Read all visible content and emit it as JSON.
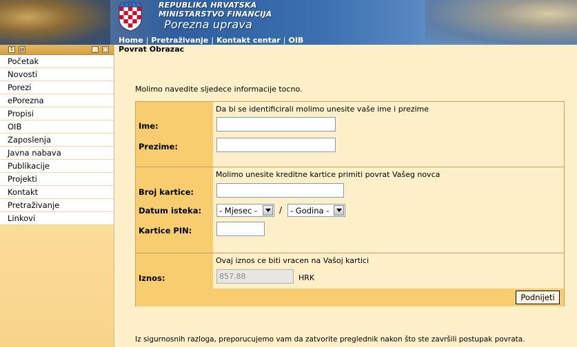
{
  "header": {
    "title_line1": "REPUBLIKA HRVATSKA",
    "title_line2": "MINISTARSTVO FINANCIJA",
    "title_line3": "Porezna uprava"
  },
  "topnav": {
    "items": [
      "Home",
      "Pretraživanje",
      "Kontakt centar",
      "OIB"
    ],
    "separator": "|"
  },
  "sidebar": {
    "items": [
      "Početak",
      "Novosti",
      "Porezi",
      "ePorezna",
      "Propisi",
      "OIB",
      "Zaposlenja",
      "Javna nabava",
      "Publikacije",
      "Projekti",
      "Kontakt",
      "Pretraživanje",
      "Linkovi"
    ]
  },
  "page": {
    "title": "Povrat Obrazac",
    "intro": "Molimo navedite sljedece informacije tocno.",
    "footer_note": "Iz sigurnosnih razloga, preporucujemo vam da zatvorite preglednik nakon što ste završili postupak povrata."
  },
  "form": {
    "section1": {
      "hint": "Da bi se identificirali molimo unesite vaše ime i prezime",
      "name_label": "Ime:",
      "name_value": "",
      "surname_label": "Prezime:",
      "surname_value": ""
    },
    "section2": {
      "hint": "Molimo unesite kreditne kartice primiti povrat Vašeg novca",
      "card_label": "Broj kartice:",
      "card_value": "",
      "expiry_label": "Datum isteka:",
      "month_selected": "- Mjesec -",
      "slash": "/",
      "year_selected": "- Godina -",
      "pin_label": "Kartice PIN:",
      "pin_value": ""
    },
    "section3": {
      "hint": "Ovaj iznos ce biti vracen na Vašoj kartici",
      "amount_label": "Iznos:",
      "amount_value": "857.88",
      "currency": "HRK"
    },
    "submit_label": "Podnijeti"
  }
}
